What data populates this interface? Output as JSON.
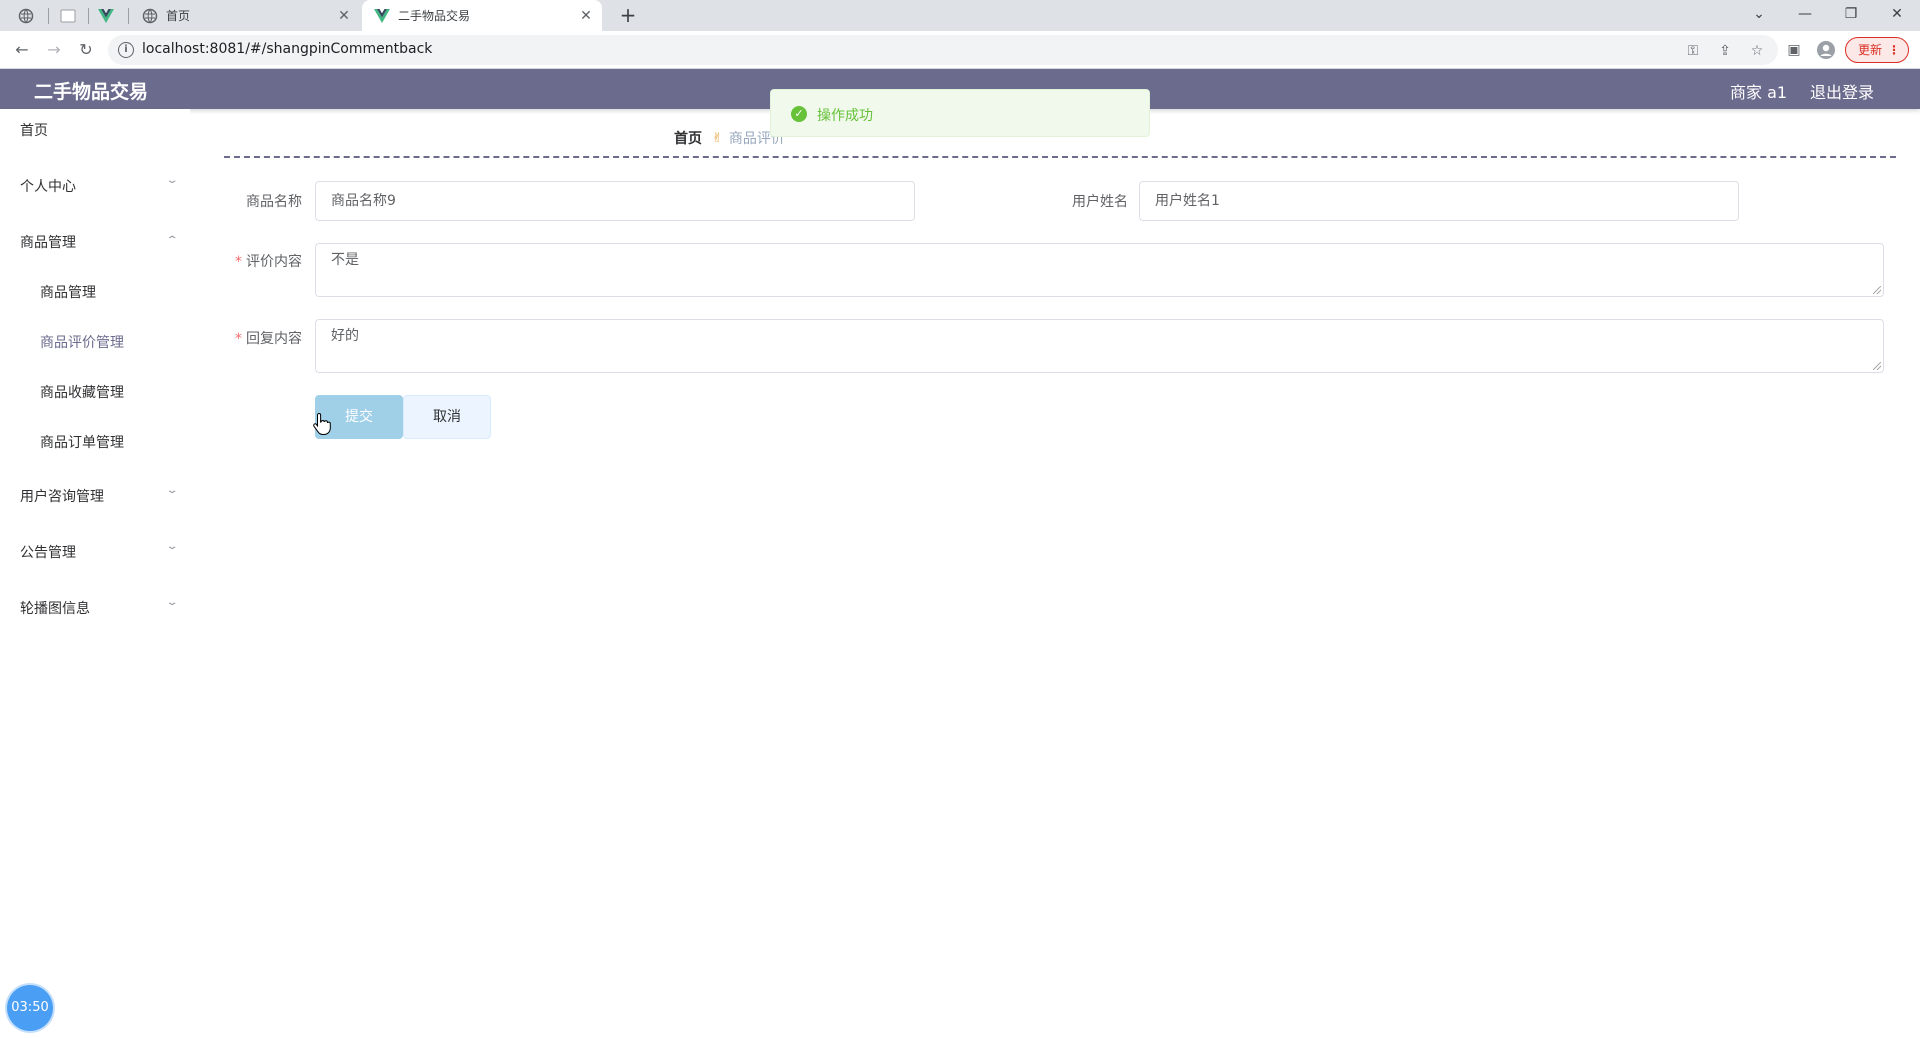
{
  "browser": {
    "tabs": [
      {
        "title": "首页",
        "icon": "globe-icon"
      },
      {
        "title": "二手物品交易",
        "icon": "vue-icon",
        "active": true
      }
    ],
    "url": "localhost:8081/#/shangpinCommentback",
    "update_label": "更新"
  },
  "header": {
    "title": "二手物品交易",
    "user": "商家 a1",
    "logout": "退出登录"
  },
  "sidebar": {
    "home": "首页",
    "personal": "个人中心",
    "goods": "商品管理",
    "goods_sub": [
      "商品管理",
      "商品评价管理",
      "商品收藏管理",
      "商品订单管理"
    ],
    "consult": "用户咨询管理",
    "notice": "公告管理",
    "carousel": "轮播图信息"
  },
  "breadcrumb": {
    "home": "首页",
    "current": "商品评价"
  },
  "form": {
    "goods_name_label": "商品名称",
    "goods_name_value": "商品名称9",
    "user_name_label": "用户姓名",
    "user_name_value": "用户姓名1",
    "comment_label": "评价内容",
    "comment_value": "不是",
    "reply_label": "回复内容",
    "reply_value": "好的",
    "submit": "提交",
    "cancel": "取消"
  },
  "toast": {
    "message": "操作成功",
    "color": "#67c23a"
  },
  "timer": "03:50",
  "colors": {
    "header_bg": "#6b6b8e",
    "active_menu": "#6b6b8e"
  }
}
